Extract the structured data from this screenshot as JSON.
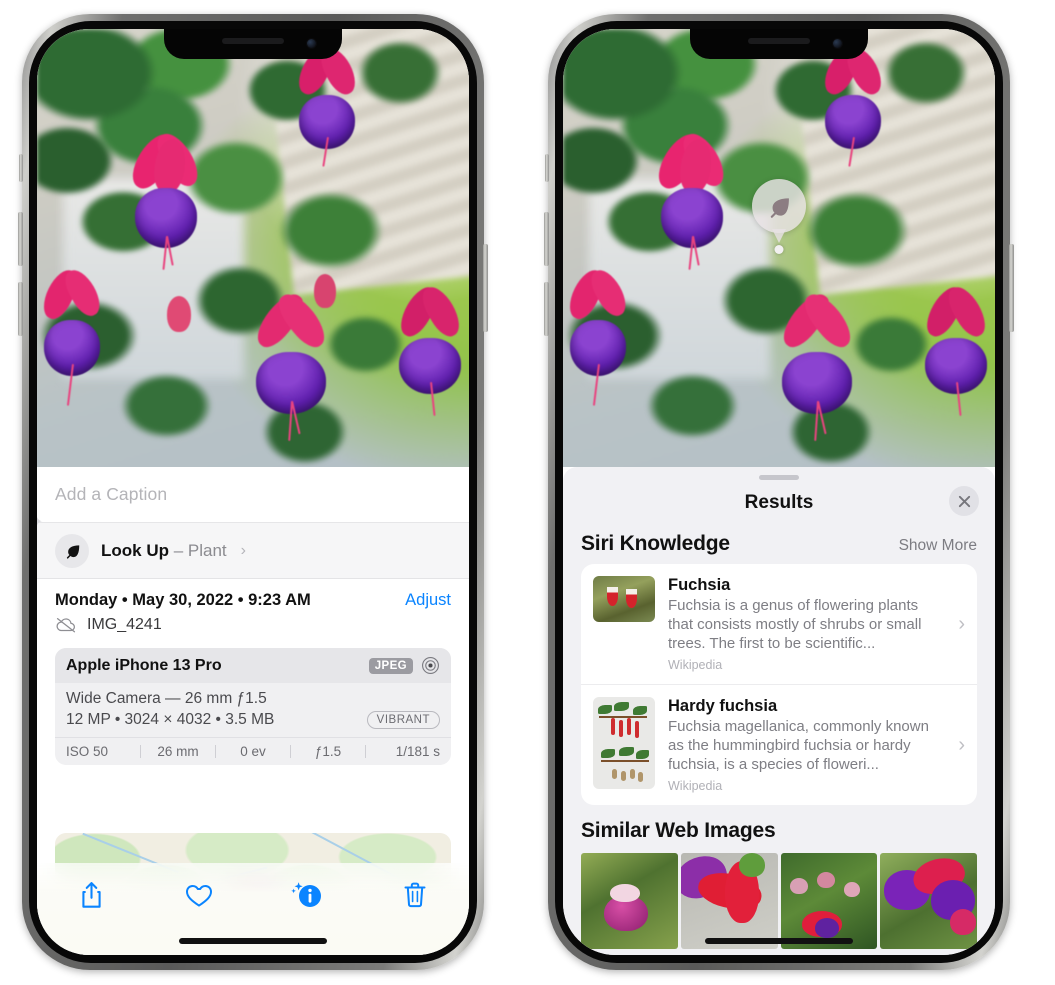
{
  "left_phone": {
    "caption_placeholder": "Add a Caption",
    "lookup": {
      "label": "Look Up",
      "dash": " – ",
      "subject": "Plant",
      "chevron": "›",
      "icon": "leaf-icon"
    },
    "date_line": "Monday • May 30, 2022 • 9:23 AM",
    "adjust_label": "Adjust",
    "filename": "IMG_4241",
    "cloud_icon": "cloud-slash-icon",
    "metadata": {
      "device": "Apple iPhone 13 Pro",
      "format_badge": "JPEG",
      "aperture_icon": "lens-icon",
      "lens_line": "Wide Camera — 26 mm ƒ1.5",
      "specs_line": "12 MP • 3024 × 4032 • 3.5 MB",
      "style_badge": "VIBRANT",
      "exif": [
        "ISO 50",
        "26 mm",
        "0 ev",
        "ƒ1.5",
        "1/181 s"
      ]
    },
    "toolbar": [
      {
        "name": "share-button",
        "icon": "share-icon"
      },
      {
        "name": "favorite-button",
        "icon": "heart-icon"
      },
      {
        "name": "info-button",
        "icon": "info-sparkle-icon"
      },
      {
        "name": "delete-button",
        "icon": "trash-icon"
      }
    ],
    "accent_color": "#0a84ff"
  },
  "right_phone": {
    "visual_lookup_badge": {
      "icon": "leaf-icon"
    },
    "sheet": {
      "title": "Results",
      "close_icon": "close-icon",
      "siri_knowledge": {
        "heading": "Siri Knowledge",
        "show_more": "Show More",
        "items": [
          {
            "title": "Fuchsia",
            "description": "Fuchsia is a genus of flowering plants that consists mostly of shrubs or small trees. The first to be scientific...",
            "source": "Wikipedia",
            "chevron": "›"
          },
          {
            "title": "Hardy fuchsia",
            "description": "Fuchsia magellanica, commonly known as the hummingbird fuchsia or hardy fuchsia, is a species of floweri...",
            "source": "Wikipedia",
            "chevron": "›"
          }
        ]
      },
      "similar_web_images": {
        "heading": "Similar Web Images",
        "count": 4
      }
    }
  }
}
